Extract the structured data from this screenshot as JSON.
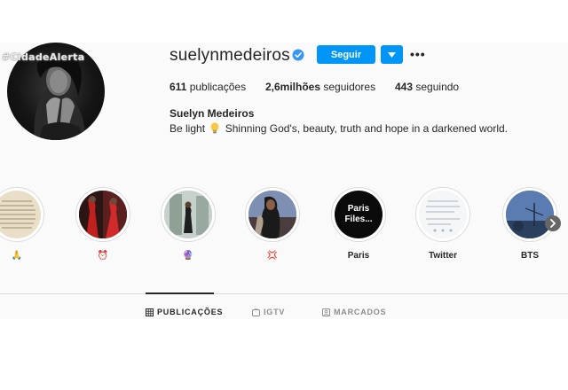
{
  "watermark": "#CidadeAlerta",
  "profile": {
    "username": "suelynmedeiros",
    "follow_label": "Seguir",
    "full_name": "Suelyn Medeiros",
    "bio_before": "Be light",
    "bio_after": "Shinning God's, beauty, truth and hope in a darkened world.",
    "stats": {
      "posts_value": "611",
      "posts_label": "publicações",
      "followers_value": "2,6milhões",
      "followers_label": "seguidores",
      "following_value": "443",
      "following_label": "seguindo"
    }
  },
  "highlights": [
    {
      "label": "🙏",
      "cover_text": ""
    },
    {
      "label": "⏰",
      "cover_text": ""
    },
    {
      "label": "🔮",
      "cover_text": ""
    },
    {
      "label": "💢",
      "cover_text": ""
    },
    {
      "label": "Paris",
      "cover_text": "Paris Files..."
    },
    {
      "label": "Twitter",
      "cover_text": ""
    },
    {
      "label": "BTS",
      "cover_text": ""
    }
  ],
  "tabs": [
    {
      "label": "PUBLICAÇÕES",
      "icon": "grid-icon",
      "active": true
    },
    {
      "label": "IGTV",
      "icon": "igtv-icon",
      "active": false
    },
    {
      "label": "MARCADOS",
      "icon": "tagged-icon",
      "active": false
    }
  ],
  "colors": {
    "accent": "#0095f6",
    "text": "#262626",
    "muted": "#8e8e8e"
  }
}
